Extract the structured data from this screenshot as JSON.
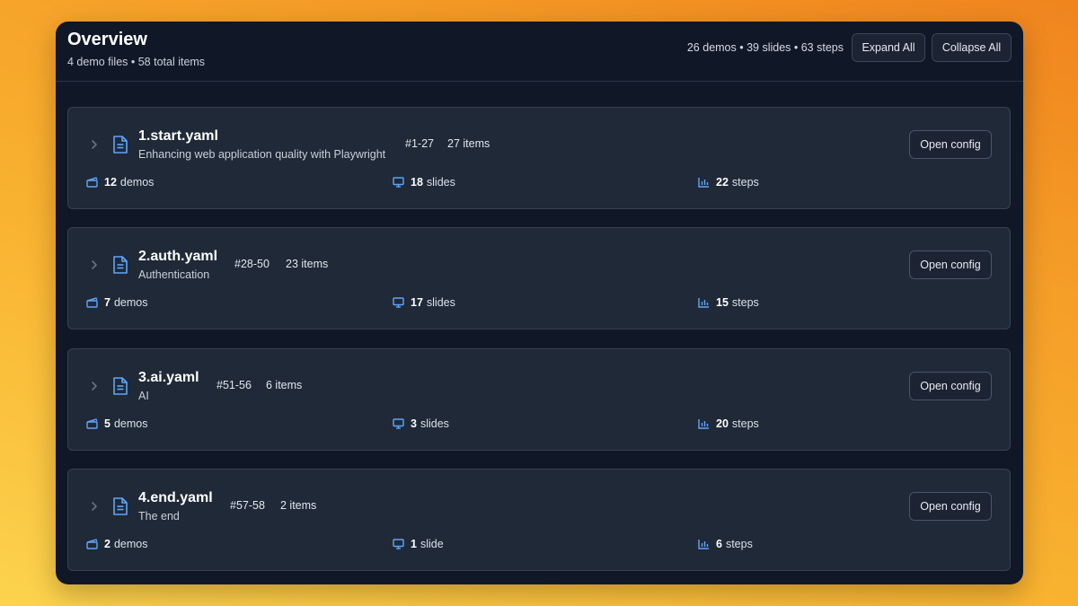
{
  "header": {
    "title": "Overview",
    "subtitle": "4 demo files • 58 total items",
    "summary": "26 demos • 39 slides • 63 steps",
    "expand_label": "Expand All",
    "collapse_label": "Collapse All"
  },
  "colors": {
    "accent_icon": "#60a5fa",
    "panel_bg": "#101827",
    "card_bg": "#1f2937"
  },
  "files": [
    {
      "name": "1.start.yaml",
      "description": "Enhancing web application quality with Playwright",
      "range": "#1-27",
      "items": "27 items",
      "open_label": "Open config",
      "demos_n": "12",
      "demos_label": "demos",
      "slides_n": "18",
      "slides_label": "slides",
      "steps_n": "22",
      "steps_label": "steps"
    },
    {
      "name": "2.auth.yaml",
      "description": "Authentication",
      "range": "#28-50",
      "items": "23 items",
      "open_label": "Open config",
      "demos_n": "7",
      "demos_label": "demos",
      "slides_n": "17",
      "slides_label": "slides",
      "steps_n": "15",
      "steps_label": "steps"
    },
    {
      "name": "3.ai.yaml",
      "description": "AI",
      "range": "#51-56",
      "items": "6 items",
      "open_label": "Open config",
      "demos_n": "5",
      "demos_label": "demos",
      "slides_n": "3",
      "slides_label": "slides",
      "steps_n": "20",
      "steps_label": "steps"
    },
    {
      "name": "4.end.yaml",
      "description": "The end",
      "range": "#57-58",
      "items": "2 items",
      "open_label": "Open config",
      "demos_n": "2",
      "demos_label": "demos",
      "slides_n": "1",
      "slides_label": "slide",
      "steps_n": "6",
      "steps_label": "steps"
    }
  ]
}
